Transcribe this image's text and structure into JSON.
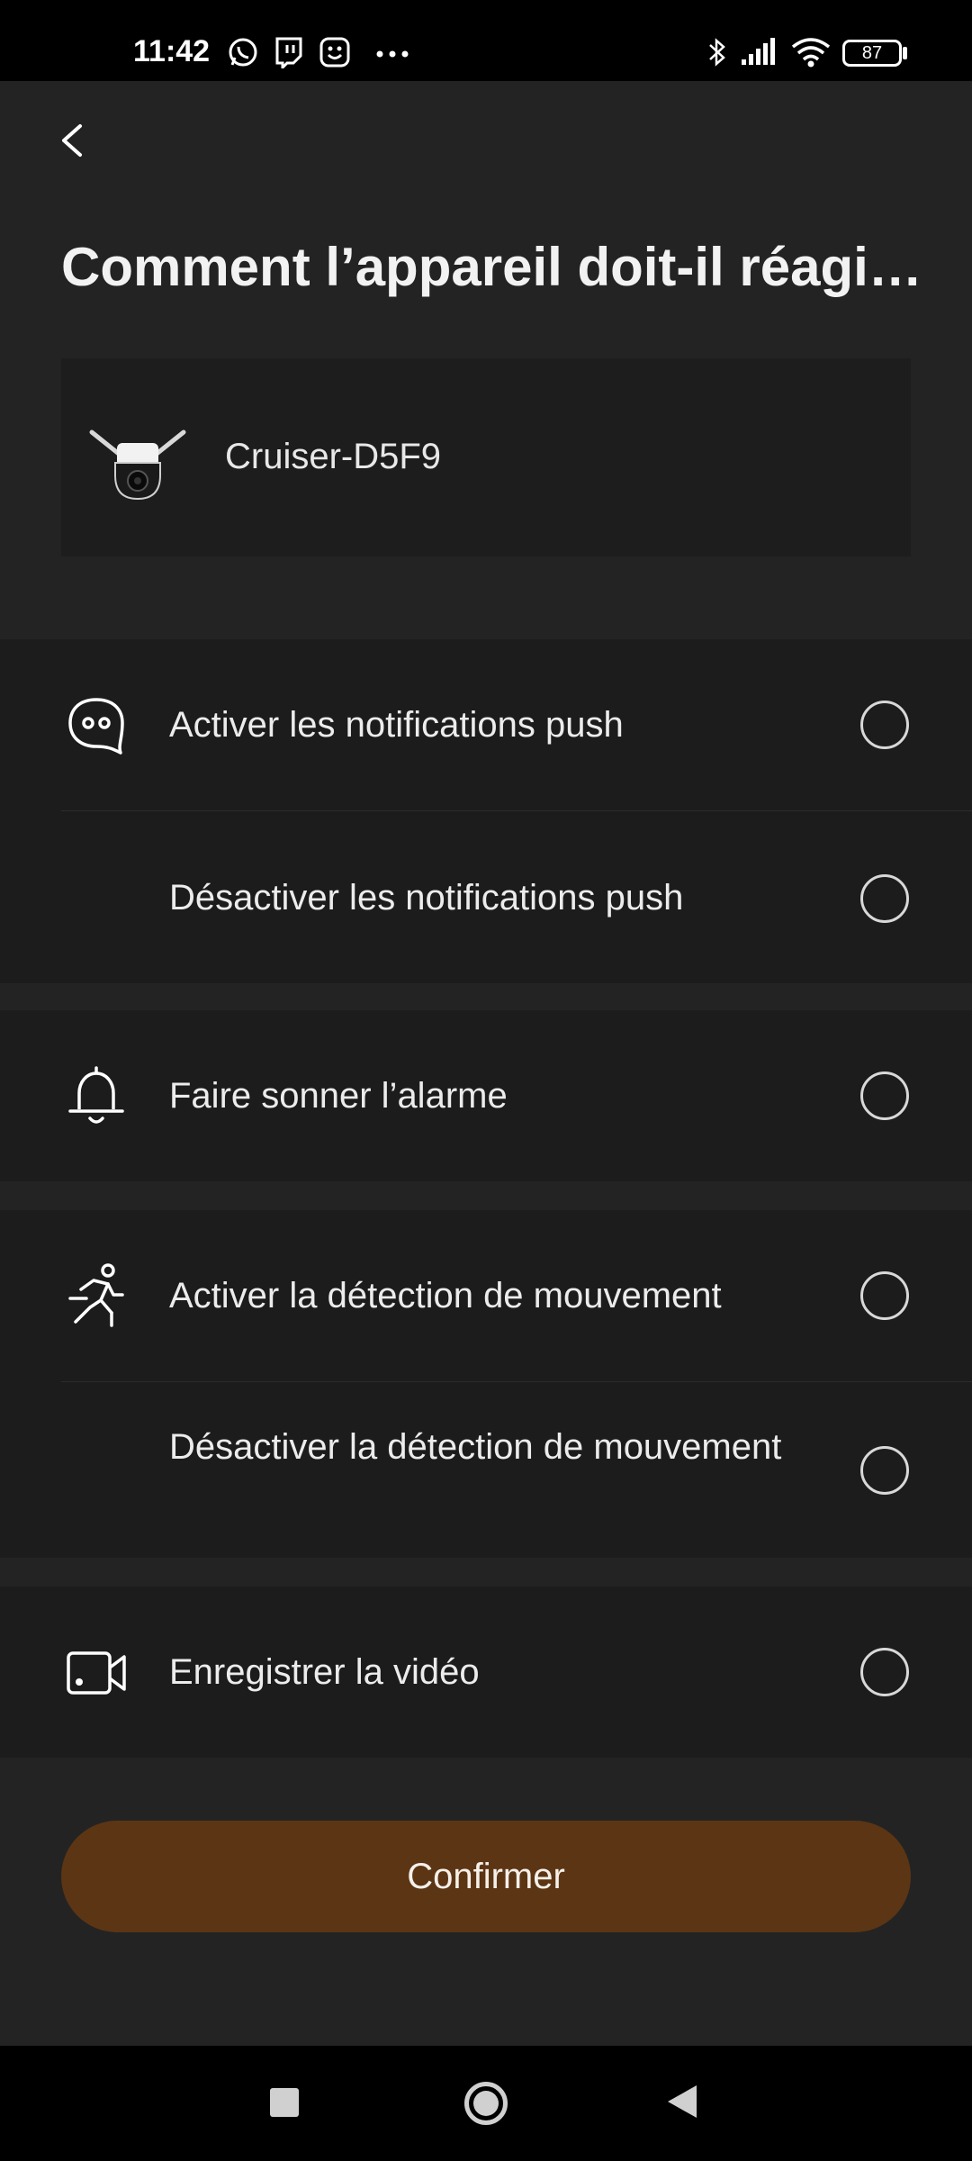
{
  "status_bar": {
    "time": "11:42",
    "icons": [
      "whatsapp-icon",
      "twitch-icon",
      "smiley-app-icon",
      "more-dots-icon",
      "bluetooth-icon",
      "signal-icon",
      "wifi-icon"
    ],
    "battery": "87"
  },
  "header": {
    "back_icon": "chevron-left-icon",
    "title": "Comment l’appareil doit-il réagi…"
  },
  "device": {
    "name": "Cruiser-D5F9",
    "image": "security-camera-image"
  },
  "options": [
    {
      "label": "Activer les notifications push",
      "icon": "chat-bubble-icon",
      "selected": false
    },
    {
      "label": "Désactiver les notifications push",
      "icon": "",
      "selected": false
    },
    {
      "label": "Faire sonner l’alarme",
      "icon": "bell-icon",
      "selected": false
    },
    {
      "label": "Activer la détection de mouvement",
      "icon": "running-person-icon",
      "selected": false
    },
    {
      "label": "Désactiver la détection de mouvement",
      "icon": "",
      "selected": false
    },
    {
      "label": "Enregistrer la vidéo",
      "icon": "video-camera-icon",
      "selected": false
    }
  ],
  "confirm_label": "Confirmer",
  "colors": {
    "background": "#232323",
    "card": "#1c1c1c",
    "accent": "#5c3514"
  },
  "nav_bar": {
    "icons": [
      "recents-square-icon",
      "home-circle-icon",
      "back-triangle-icon"
    ]
  }
}
